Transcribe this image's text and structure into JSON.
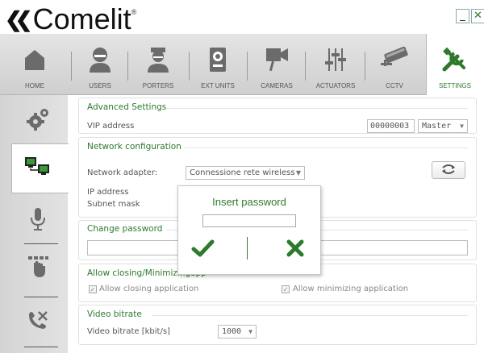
{
  "app": {
    "logo_text": "Comelit",
    "logo_mark": "«",
    "registered": "®"
  },
  "window": {
    "minimize_label": "_",
    "close_label": "✕"
  },
  "colors": {
    "accent": "#2d7a2d",
    "nav_bg": "#d9d9d9",
    "text": "#555555"
  },
  "nav": {
    "items": [
      {
        "label": "HOME",
        "icon": "home-icon"
      },
      {
        "label": "USERS",
        "icon": "user-icon"
      },
      {
        "label": "PORTERS",
        "icon": "porter-icon"
      },
      {
        "label": "EXT UNITS",
        "icon": "external-unit-icon"
      },
      {
        "label": "CAMERAS",
        "icon": "camera-icon"
      },
      {
        "label": "ACTUATORS",
        "icon": "sliders-icon"
      },
      {
        "label": "CCTV",
        "icon": "cctv-icon"
      },
      {
        "label": "SETTINGS",
        "icon": "tools-icon"
      }
    ],
    "active": "SETTINGS"
  },
  "sidebar": {
    "items": [
      {
        "icon": "gears-icon"
      },
      {
        "icon": "network-computers-icon",
        "active": true
      },
      {
        "icon": "microphone-icon"
      },
      {
        "icon": "keypad-hand-icon"
      },
      {
        "icon": "phone-tools-icon"
      }
    ]
  },
  "advanced": {
    "title": "Advanced Settings",
    "vip_label": "VIP address",
    "vip_value": "00000003",
    "role_value": "Master"
  },
  "network": {
    "title": "Network configuration",
    "adapter_label": "Network adapter:",
    "adapter_value": "Connessione rete wireless",
    "ip_label": "IP address",
    "mask_label": "Subnet mask"
  },
  "password": {
    "title": "Change password",
    "value": ""
  },
  "closing": {
    "title": "Allow closing/Minimizing",
    "title_suffix": "app",
    "closing_label": "Allow closing application",
    "closing_checked": true,
    "minimizing_label": "Allow minimizing application",
    "minimizing_checked": true
  },
  "bitrate": {
    "title": "Video bitrate",
    "label": "Video bitrate [kbit/s]",
    "value": "1000"
  },
  "popup": {
    "title": "Insert password",
    "value": ""
  }
}
